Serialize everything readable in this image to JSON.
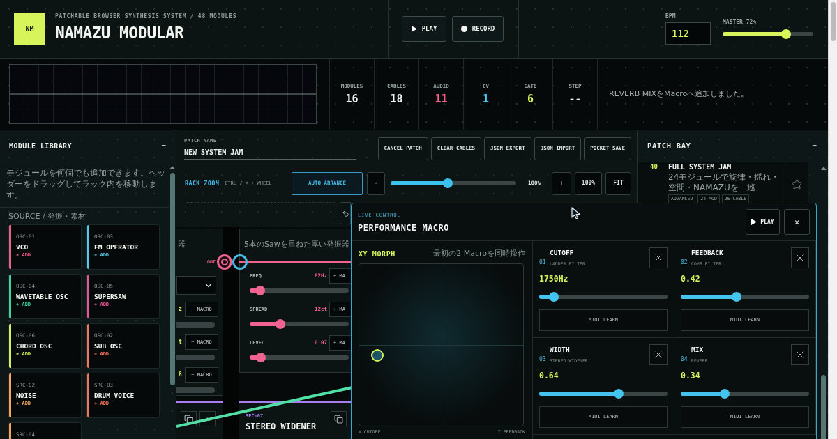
{
  "header": {
    "logo": "NM",
    "subtitle": "PATCHABLE BROWSER SYNTHESIS SYSTEM / 48 MODULES",
    "title": "NAMAZU MODULAR",
    "transport": [
      {
        "kind": "play",
        "label": "PLAY"
      },
      {
        "kind": "record",
        "label": "RECORD"
      }
    ],
    "bpm": {
      "label": "BPM",
      "value": "112"
    },
    "master": {
      "label": "MASTER 72%",
      "level": 0.72
    }
  },
  "monitor": {
    "stats": [
      {
        "label": "MODULES",
        "value": "16",
        "color": "#f2f5f2"
      },
      {
        "label": "CABLES",
        "value": "18",
        "color": "#f2f5f2"
      },
      {
        "label": "AUDIO",
        "value": "11",
        "color": "#f0608a"
      },
      {
        "label": "CV",
        "value": "1",
        "color": "#4cc9f0"
      },
      {
        "label": "GATE",
        "value": "6",
        "color": "#d7f55a"
      },
      {
        "label": "STEP",
        "value": "--",
        "color": "#f2f5f2"
      }
    ],
    "message": "REVERB MIXをMacroへ追加しました。"
  },
  "library": {
    "title": "MODULE LIBRARY",
    "collapse": "−",
    "description": "モジュールを何個でも追加できます。ヘッダーをドラッグしてラック内を移動します。",
    "section": "SOURCE / 発振・素材",
    "modules": [
      {
        "code": "OSC-01",
        "name": "VCO",
        "add": "+ ADD",
        "color": "#ef5d8a"
      },
      {
        "code": "OSC-03",
        "name": "FM OPERATOR",
        "add": "+ ADD",
        "color": "#56c6ec"
      },
      {
        "code": "OSC-04",
        "name": "WAVETABLE OSC",
        "add": "+ ADD",
        "color": "#3fd3a0"
      },
      {
        "code": "OSC-05",
        "name": "SUPERSAW",
        "add": "+ ADD",
        "color": "#e8569a"
      },
      {
        "code": "OSC-06",
        "name": "CHORD OSC",
        "add": "+ ADD",
        "color": "#d6ef62"
      },
      {
        "code": "OSC-02",
        "name": "SUB OSC",
        "add": "+ ADD",
        "color": "#f0765c"
      },
      {
        "code": "SRC-02",
        "name": "NOISE",
        "add": "+ ADD",
        "color": "#f2a85c"
      },
      {
        "code": "SRC-03",
        "name": "DRUM VOICE",
        "add": "+ ADD",
        "color": "#f0765c"
      },
      {
        "code": "SRC-04",
        "color": "#f2a85c"
      }
    ]
  },
  "patch": {
    "name_label": "PATCH NAME",
    "name": "NEW SYSTEM JAM",
    "actions": [
      "CANCEL PATCH",
      "CLEAR CABLES",
      "JSON EXPORT",
      "JSON IMPORT",
      "POCKET SAVE"
    ],
    "zoom": {
      "label": "RACK ZOOM",
      "hint": "CTRL / ⌘ + WHEEL",
      "arrange": "AUTO ARRANGE",
      "out": "-",
      "level": 0.45,
      "reading": "100%",
      "in": "+",
      "reset": "100%",
      "fit": "FIT"
    }
  },
  "rack": {
    "out_label": "OUT",
    "cables": [
      {
        "color": "#f0628f"
      },
      {
        "color": "#52e0a6"
      }
    ],
    "modules": [
      {
        "kind": "cut",
        "title": "器",
        "params": [
          {
            "value": "z",
            "macro": "+ MACRO"
          },
          {
            "value": "t",
            "macro": "+ MACRO"
          },
          {
            "value": "8",
            "macro": "+ MACRO"
          }
        ]
      },
      {
        "kind": "full",
        "title": "5本のSawを重ねた厚い発振器",
        "params": [
          {
            "name": "FREQ",
            "value": "82Hz",
            "macro": "+ MA",
            "level": 0.06
          },
          {
            "name": "SPREAD",
            "value": "12ct",
            "macro": "+ MA",
            "level": 0.29
          },
          {
            "name": "LEVEL",
            "value": "0.07",
            "macro": "+ MA",
            "level": 0.07
          }
        ]
      }
    ],
    "lower_modules": [
      {
        "kind": "tools"
      },
      {
        "kind": "titled",
        "code": "SPC-07",
        "name": "STEREO WIDENER"
      }
    ]
  },
  "patch_bay": {
    "title": "PATCH BAY",
    "collapse": "−",
    "presets": [
      {
        "number": "40",
        "name": "FULL SYSTEM JAM",
        "description": "24モジュールで旋律・揺れ・空間・NAMAZUを一巡",
        "tags": [
          "ADVANCED",
          "24 MOD",
          "26 CABLE"
        ],
        "starred": false
      }
    ]
  },
  "macro_panel": {
    "eyebrow": "LIVE CONTROL",
    "title": "PERFORMANCE MACRO",
    "play": "PLAY",
    "close": "×",
    "xy": {
      "title": "XY MORPH",
      "hint": "最初の2 Macroを同時操作",
      "x_label": "X CUTOFF",
      "y_label": "Y FEEDBACK"
    },
    "macros": [
      {
        "index": "01",
        "name": "CUTOFF",
        "target": "LADDER FILTER",
        "value": "1750Hz",
        "level": 0.08,
        "learn": "MIDI LEARN"
      },
      {
        "index": "02",
        "name": "FEEDBACK",
        "target": "COMB FILTER",
        "value": "0.42",
        "level": 0.43,
        "learn": "MIDI LEARN"
      },
      {
        "index": "03",
        "name": "WIDTH",
        "target": "STEREO WIDENER",
        "value": "0.64",
        "level": 0.63,
        "learn": "MIDI LEARN"
      },
      {
        "index": "04",
        "name": "MIX",
        "target": "REVERB",
        "value": "0.34",
        "level": 0.33,
        "learn": "MIDI LEARN"
      }
    ]
  }
}
